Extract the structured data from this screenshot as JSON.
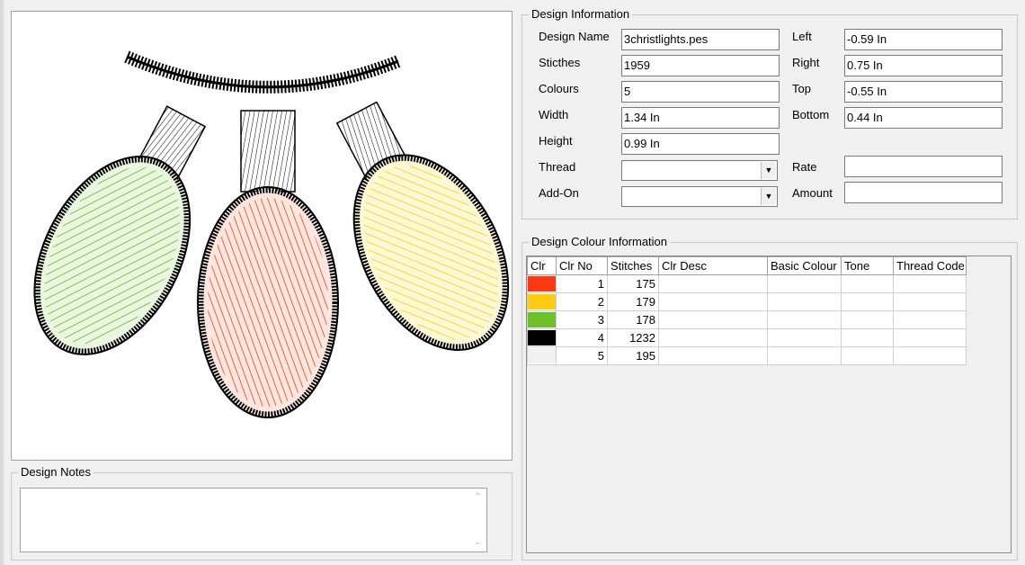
{
  "design_info": {
    "legend": "Design Information",
    "fields_left": [
      {
        "label": "Design Name",
        "value": "3christlights.pes"
      },
      {
        "label": "Sticthes",
        "value": "1959"
      },
      {
        "label": "Colours",
        "value": "5"
      },
      {
        "label": "Width",
        "value": "1.34 In"
      },
      {
        "label": "Height",
        "value": "0.99 In"
      }
    ],
    "thread_label": "Thread",
    "thread_value": "",
    "addon_label": "Add-On",
    "addon_value": "",
    "fields_right": [
      {
        "label": "Left",
        "value": "-0.59 In"
      },
      {
        "label": "Right",
        "value": "0.75 In"
      },
      {
        "label": "Top",
        "value": "-0.55 In"
      },
      {
        "label": "Bottom",
        "value": "0.44 In"
      }
    ],
    "rate_label": "Rate",
    "rate_value": "",
    "amount_label": "Amount",
    "amount_value": ""
  },
  "colour_info": {
    "legend": "Design Colour Information",
    "columns": [
      "Clr",
      "Clr No",
      "Stitches",
      "Clr Desc",
      "Basic Colour",
      "Tone",
      "Thread Code"
    ],
    "rows": [
      {
        "color": "#ff3a12",
        "clr_no": "1",
        "stitches": "175",
        "desc": "",
        "basic": "",
        "tone": "",
        "code": ""
      },
      {
        "color": "#ffcc11",
        "clr_no": "2",
        "stitches": "179",
        "desc": "",
        "basic": "",
        "tone": "",
        "code": ""
      },
      {
        "color": "#6cc02a",
        "clr_no": "3",
        "stitches": "178",
        "desc": "",
        "basic": "",
        "tone": "",
        "code": ""
      },
      {
        "color": "#000000",
        "clr_no": "4",
        "stitches": "1232",
        "desc": "",
        "basic": "",
        "tone": "",
        "code": ""
      },
      {
        "color": "#f0f0f0",
        "clr_no": "5",
        "stitches": "195",
        "desc": "",
        "basic": "",
        "tone": "",
        "code": ""
      }
    ]
  },
  "notes": {
    "legend": "Design Notes",
    "text": ""
  },
  "icons": {
    "scroll_up": "chevron-up-icon",
    "scroll_down": "chevron-down-icon",
    "dropdown": "dropdown-arrow-icon"
  }
}
